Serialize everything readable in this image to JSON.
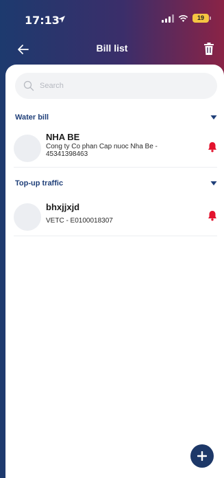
{
  "status_bar": {
    "time": "17:13",
    "battery": "19"
  },
  "header": {
    "title": "Bill list"
  },
  "search": {
    "placeholder": "Search"
  },
  "sections": [
    {
      "title": "Water bill",
      "items": [
        {
          "name": "NHA BE",
          "description": "Cong ty Co phan Cap nuoc Nha Be - 45341398463"
        }
      ]
    },
    {
      "title": "Top-up traffic",
      "items": [
        {
          "name": "bhxjjxjd",
          "description": "VETC - E0100018307"
        }
      ]
    }
  ],
  "colors": {
    "accent": "#1f3f79",
    "alert": "#e3122d",
    "fab": "#1d3868"
  },
  "icons": [
    "location-arrow-icon",
    "signal-icon",
    "wifi-icon",
    "battery-icon",
    "back-arrow-icon",
    "trash-icon",
    "search-icon",
    "chevron-down-icon",
    "bell-icon",
    "plus-icon"
  ]
}
